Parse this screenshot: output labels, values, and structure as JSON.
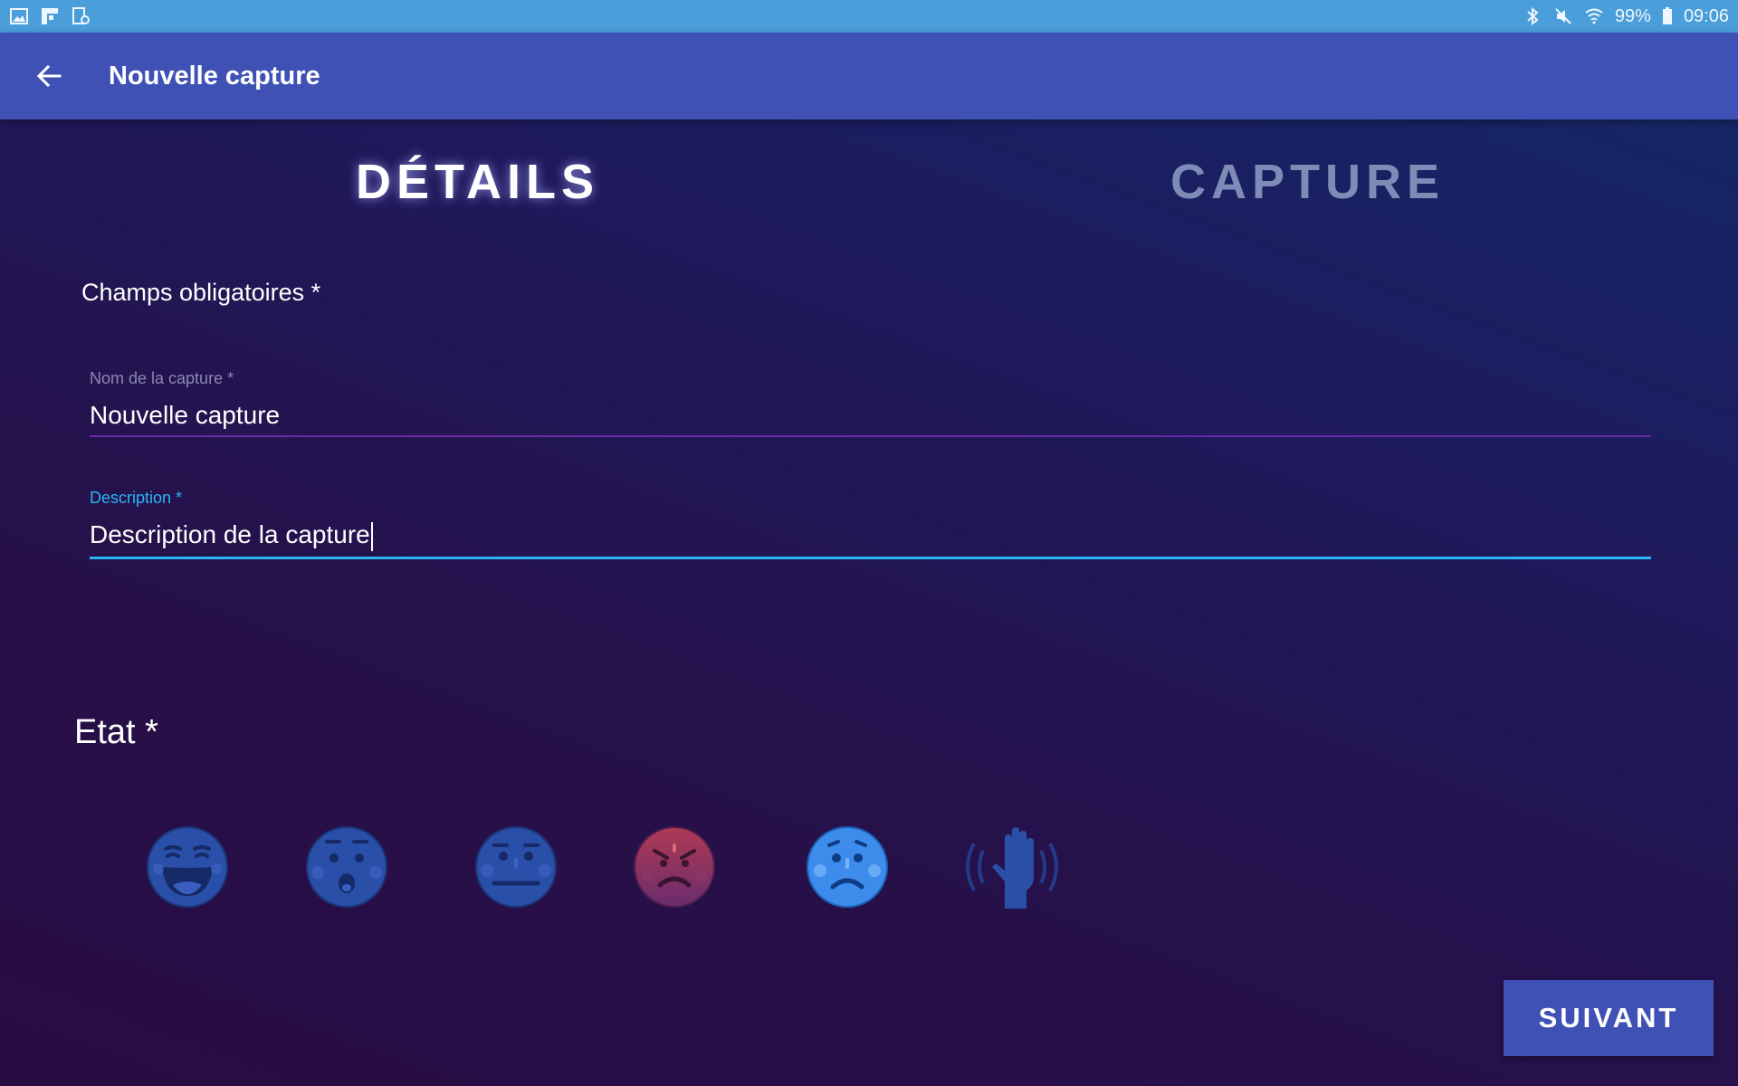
{
  "status_bar": {
    "left_icons": [
      "image-icon",
      "flipboard-icon",
      "screen-recorder-icon"
    ],
    "right_icons": [
      "bluetooth-icon",
      "mute-icon",
      "wifi-icon",
      "battery-icon"
    ],
    "battery": "99%",
    "time": "09:06"
  },
  "app_bar": {
    "back_icon": "arrow-back-icon",
    "title": "Nouvelle capture",
    "color": "#3f51b5"
  },
  "tabs": [
    {
      "label": "DÉTAILS",
      "active": true
    },
    {
      "label": "CAPTURE",
      "active": false
    }
  ],
  "form": {
    "required_note": "Champs obligatoires *",
    "name_field": {
      "label": "Nom de la capture *",
      "value": "Nouvelle capture"
    },
    "description_field": {
      "label": "Description *",
      "value": "Description de la capture",
      "focused": true
    }
  },
  "etat": {
    "label": "Etat *",
    "options": [
      {
        "icon": "laughing-face-icon",
        "selected": false
      },
      {
        "icon": "surprised-face-icon",
        "selected": false
      },
      {
        "icon": "neutral-face-icon",
        "selected": false
      },
      {
        "icon": "angry-face-icon",
        "selected": false
      },
      {
        "icon": "sad-face-icon",
        "selected": true
      },
      {
        "icon": "raised-hand-icon",
        "selected": false
      }
    ]
  },
  "next_button": {
    "label": "SUIVANT"
  },
  "colors": {
    "accent": "#29b6f6",
    "primary": "#3f51b5",
    "status_bar": "#4a9ed9"
  }
}
